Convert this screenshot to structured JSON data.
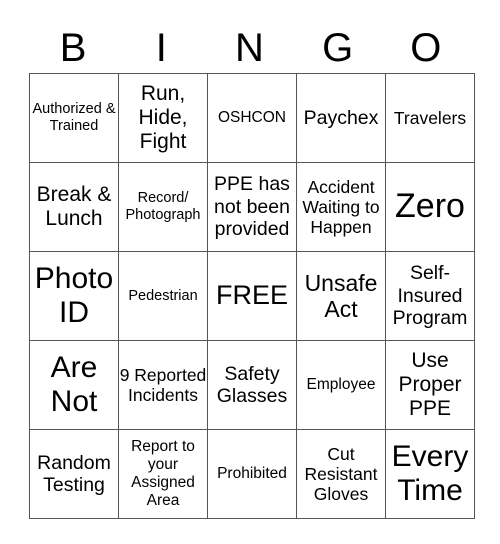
{
  "header": {
    "letters": [
      "B",
      "I",
      "N",
      "G",
      "O"
    ]
  },
  "grid": {
    "rows": [
      [
        "Authorized & Trained",
        "Run, Hide, Fight",
        "OSHCON",
        "Paychex",
        "Travelers"
      ],
      [
        "Break & Lunch",
        "Record/ Photograph",
        "PPE has not been provided",
        "Accident Waiting to Happen",
        "Zero"
      ],
      [
        "Photo ID",
        "Pedestrian",
        "FREE",
        "Unsafe Act",
        "Self-Insured Program"
      ],
      [
        "Are Not",
        "9 Reported Incidents",
        "Safety Glasses",
        "Employee",
        "Use Proper PPE"
      ],
      [
        "Random Testing",
        "Report to your Assigned Area",
        "Prohibited",
        "Cut Resistant Gloves",
        "Every Time"
      ]
    ]
  }
}
